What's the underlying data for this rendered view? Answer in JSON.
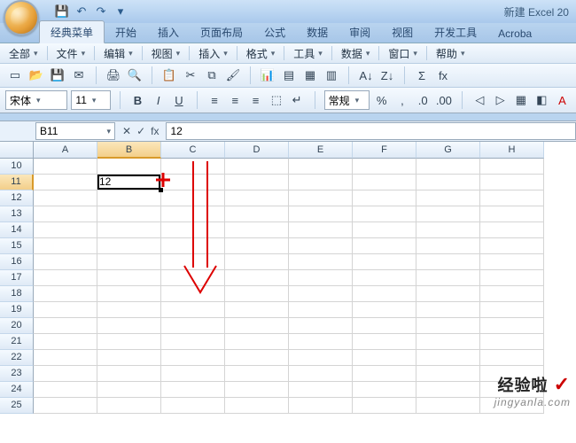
{
  "title_text": "新建 Excel 20",
  "qat": {
    "save": "💾",
    "undo": "↶",
    "redo": "↷",
    "more": "▾"
  },
  "tabs": {
    "classic": "经典菜单",
    "home": "开始",
    "insert": "插入",
    "layout": "页面布局",
    "formula": "公式",
    "data": "数据",
    "review": "审阅",
    "view": "视图",
    "dev": "开发工具",
    "acrobat": "Acroba"
  },
  "menu": {
    "all": "全部",
    "file": "文件",
    "edit": "编辑",
    "view": "视图",
    "insert": "插入",
    "format": "格式",
    "tools": "工具",
    "data": "数据",
    "window": "窗口",
    "help": "帮助"
  },
  "toolbar": {
    "new": "▭",
    "open": "📂",
    "save": "💾",
    "mail": "✉",
    "print": "🖨",
    "preview": "🔍",
    "paste": "📋",
    "chart": "📊",
    "cut": "✂",
    "copy": "⧉",
    "brush": "🖌",
    "sort_asc": "A↓",
    "sort_desc": "Z↓",
    "sigma": "Σ",
    "fx": "fx",
    "d1": "▤",
    "d2": "▦",
    "d3": "▥"
  },
  "fmt": {
    "font": "宋体",
    "size": "11",
    "bold": "B",
    "italic": "I",
    "underline": "U",
    "al": "≡",
    "ac": "≡",
    "ar": "≡",
    "merge": "⬚",
    "wrap": "↵",
    "cur": "常规",
    "pct": "%",
    "comma": ",",
    "dec_inc": ".0",
    "dec_dec": ".00",
    "bord": "▦",
    "fill": "◧",
    "fcolor": "A",
    "indent_dec": "◁",
    "indent_inc": "▷"
  },
  "namebox": "B11",
  "fx_label": "fx",
  "formula_value": "12",
  "columns": [
    "A",
    "B",
    "C",
    "D",
    "E",
    "F",
    "G",
    "H"
  ],
  "rows": [
    "10",
    "11",
    "12",
    "13",
    "14",
    "15",
    "16",
    "17",
    "18",
    "19",
    "20",
    "21",
    "22",
    "23",
    "24",
    "25"
  ],
  "active_cell_value": "12",
  "watermark": {
    "line1": "经验啦",
    "check": "✓",
    "line2": "jingyanla.com"
  }
}
